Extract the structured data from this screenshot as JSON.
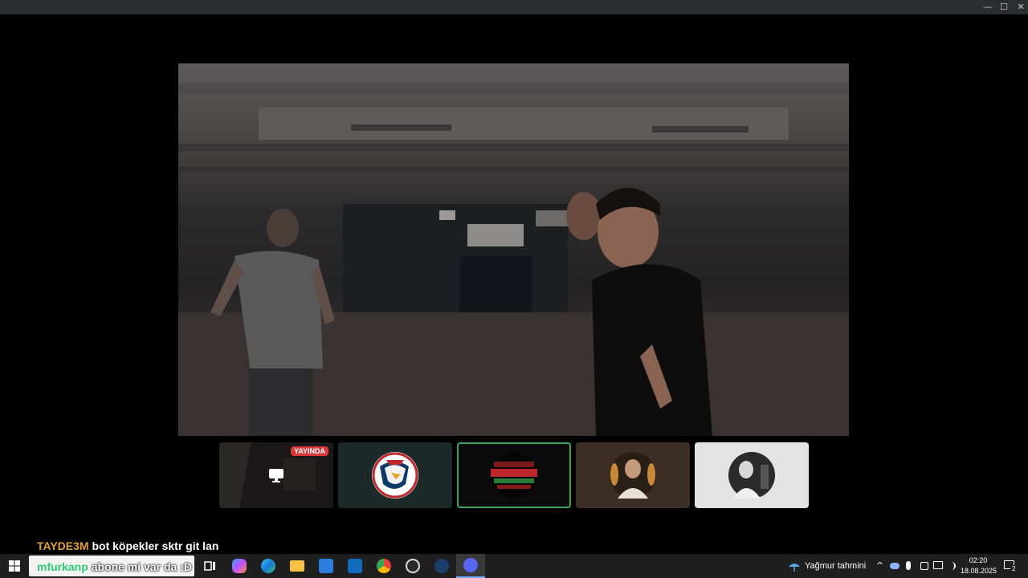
{
  "window": {
    "minimize_glyph": "—",
    "maximize_glyph": "☐",
    "close_glyph": "✕"
  },
  "participants": [
    {
      "name": "screen-share",
      "badge": "YAYINDA",
      "icon": "monitor-icon"
    },
    {
      "name": "eagle-logo"
    },
    {
      "name": "banner-logo",
      "active": true
    },
    {
      "name": "man-photo"
    },
    {
      "name": "bw-photo"
    }
  ],
  "chat": {
    "line1": {
      "user": "TAYDE3M",
      "user_color": "#e0a040",
      "message": "bot köpekler sktr git lan"
    },
    "line2": {
      "user": "mfurkanp",
      "user_color": "#2ecc71",
      "message": "abone mi var da :D"
    }
  },
  "taskbar": {
    "weather": "Yağmur tahmini",
    "time": "02:20",
    "date": "18.08.2025",
    "notifications": "2",
    "apps": [
      "start-icon",
      "task-view-icon",
      "copilot-icon",
      "edge-icon",
      "file-explorer-icon",
      "store-icon",
      "outlook-icon",
      "chrome-icon",
      "app-icon",
      "steam-icon",
      "discord-icon"
    ]
  },
  "colors": {
    "live": "#da373c",
    "active_border": "#3ba55c",
    "taskbar": "#1f1f1f"
  }
}
